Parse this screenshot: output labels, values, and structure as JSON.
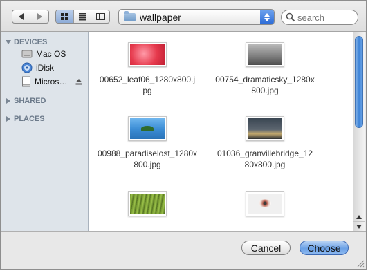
{
  "toolbar": {
    "path_label": "wallpaper",
    "search_placeholder": "search"
  },
  "sidebar": {
    "sections": [
      {
        "label": "DEVICES",
        "expanded": true
      },
      {
        "label": "SHARED",
        "expanded": false
      },
      {
        "label": "PLACES",
        "expanded": false
      }
    ],
    "devices": [
      {
        "label": "Mac OS",
        "icon": "hard-drive-icon"
      },
      {
        "label": "iDisk",
        "icon": "idisk-icon"
      },
      {
        "label": "Micros…",
        "icon": "disk-image-icon"
      }
    ]
  },
  "files": [
    {
      "name": "00652_leaf06_1280x800.jpg",
      "line1": "00652_leaf06_1280x800.j",
      "line2": "pg"
    },
    {
      "name": "00754_dramaticsky_1280x800.jpg",
      "line1": "00754_dramaticsky_1280x",
      "line2": "800.jpg"
    },
    {
      "name": "00988_paradiselost_1280x800.jpg",
      "line1": "00988_paradiselost_1280x",
      "line2": "800.jpg"
    },
    {
      "name": "01036_granvillebridge_1280x800.jpg",
      "line1": "01036_granvillebridge_12",
      "line2": "80x800.jpg"
    },
    {
      "name": "",
      "line1": "",
      "line2": ""
    },
    {
      "name": "",
      "line1": "",
      "line2": ""
    }
  ],
  "buttons": {
    "cancel": "Cancel",
    "choose": "Choose"
  },
  "colors": {
    "accent": "#3d84d8",
    "sidebar_bg": "#dee4ea"
  }
}
